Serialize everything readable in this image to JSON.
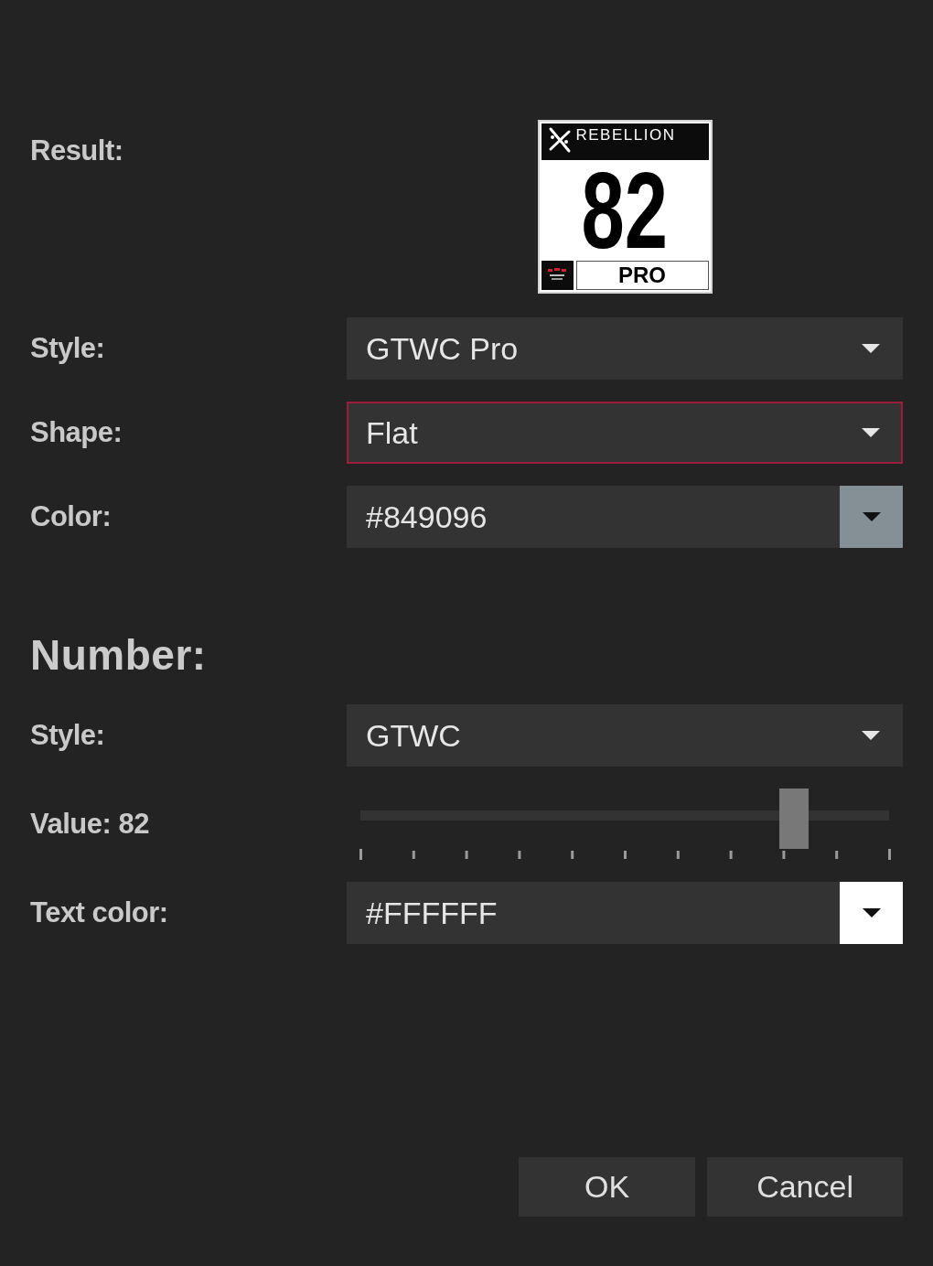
{
  "result": {
    "label": "Result:",
    "badge": {
      "brand": "REBELLION",
      "number": "82",
      "category": "PRO"
    }
  },
  "fields": [
    {
      "kind": "dropdown",
      "label": "Style:",
      "value": "GTWC Pro",
      "focused": false
    },
    {
      "kind": "dropdown",
      "label": "Shape:",
      "value": "Flat",
      "focused": true
    },
    {
      "kind": "color",
      "label": "Color:",
      "value": "#849096",
      "color": "#849096",
      "focused": false
    }
  ],
  "number": {
    "heading": "Number:",
    "fields": [
      {
        "kind": "dropdown",
        "label": "Style:",
        "value": "GTWC",
        "focused": false
      },
      {
        "kind": "slider",
        "label": "Value: 82",
        "level": 0.82,
        "focused": false
      },
      {
        "kind": "color",
        "label": "Text color:",
        "value": "#FFFFFF",
        "color": "#ffffff",
        "focused": false
      }
    ]
  },
  "buttons": [
    {
      "label": "OK"
    },
    {
      "label": "Cancel"
    }
  ]
}
